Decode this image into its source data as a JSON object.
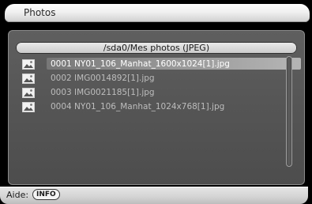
{
  "window": {
    "title": "Photos"
  },
  "browser": {
    "path": "/sda0/Mes photos (JPEG)",
    "selected_index": 0,
    "files": [
      {
        "name": "0001 NY01_106_Manhat_1600x1024[1].jpg",
        "icon": "image-file-icon"
      },
      {
        "name": "0002 IMG0014892[1].jpg",
        "icon": "image-file-icon"
      },
      {
        "name": "0003 IMG0021185[1].jpg",
        "icon": "image-file-icon"
      },
      {
        "name": "0004 NY01_106_Manhat_1024x768[1].jpg",
        "icon": "image-file-icon"
      }
    ]
  },
  "footer": {
    "help_label": "Aide:",
    "info_key": "INFO"
  },
  "colors": {
    "background": "#000000",
    "panel": "#555555",
    "selected_text": "#ffffff",
    "unselected_text": "#bdbdbd"
  }
}
